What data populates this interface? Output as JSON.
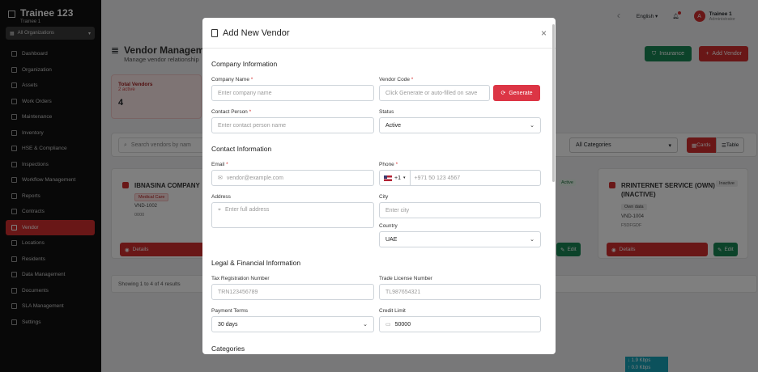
{
  "sidebar": {
    "app_name": "Trainee 123",
    "app_sub": "Trainee 1",
    "org_select": "All Organizations",
    "items": [
      {
        "label": "Dashboard"
      },
      {
        "label": "Organization"
      },
      {
        "label": "Assets"
      },
      {
        "label": "Work Orders"
      },
      {
        "label": "Maintenance"
      },
      {
        "label": "Inventory"
      },
      {
        "label": "HSE & Compliance"
      },
      {
        "label": "Inspections"
      },
      {
        "label": "Workflow Management"
      },
      {
        "label": "Reports"
      },
      {
        "label": "Contracts"
      },
      {
        "label": "Vendor",
        "active": true
      },
      {
        "label": "Locations"
      },
      {
        "label": "Residents"
      },
      {
        "label": "Data Management"
      },
      {
        "label": "Documents"
      },
      {
        "label": "SLA Management"
      },
      {
        "label": "Settings"
      }
    ]
  },
  "topbar": {
    "language": "English",
    "user_initial": "A",
    "user_name": "Trainee 1",
    "user_role": "Administrator"
  },
  "page": {
    "title": "Vendor Managem",
    "subtitle": "Manage vendor relationship",
    "insurance_label": "Insurance",
    "add_vendor_label": "Add Vendor",
    "stat": {
      "label": "Total Vendors",
      "sub": "2 active",
      "value": "4"
    },
    "search_placeholder": "Search vendors by nam",
    "category_filter": "All Categories",
    "view_cards": "Cards",
    "view_table": "Table",
    "card1": {
      "title": "IBNASINA COMPANY",
      "badge": "Medical Care",
      "code": "VND-1002",
      "code2": "0000",
      "details": "Details"
    },
    "card_mid": {
      "status": "Active",
      "edit": "Edit"
    },
    "card2": {
      "title": "RRINTERNET SERVICE (OWN) (INACTIVE)",
      "status": "Inactive",
      "badge": "Own data",
      "code": "VND-1004",
      "code2": "F5DFGDF",
      "details": "Details",
      "edit": "Edit"
    },
    "showing": "Showing 1 to 4 of 4 results",
    "speed": [
      "↓ 1.9 Kbps",
      "↑ 0.0 Kbps"
    ]
  },
  "modal": {
    "title": "Add New Vendor",
    "close": "×",
    "sections": {
      "company": "Company Information",
      "contact": "Contact Information",
      "legal": "Legal & Financial Information",
      "categories": "Categories"
    },
    "fields": {
      "company_name": {
        "label": "Company Name",
        "placeholder": "Enter company name"
      },
      "vendor_code": {
        "label": "Vendor Code",
        "placeholder": "Click Generate or auto-filled on save"
      },
      "generate": "Generate",
      "contact_person": {
        "label": "Contact Person",
        "placeholder": "Enter contact person name"
      },
      "status": {
        "label": "Status",
        "value": "Active"
      },
      "email": {
        "label": "Email",
        "placeholder": "vendor@example.com"
      },
      "phone": {
        "label": "Phone",
        "prefix": "+1",
        "placeholder": "+971 50 123 4567"
      },
      "address": {
        "label": "Address",
        "placeholder": "Enter full address"
      },
      "city": {
        "label": "City",
        "placeholder": "Enter city"
      },
      "country": {
        "label": "Country",
        "value": "UAE"
      },
      "trn": {
        "label": "Tax Registration Number",
        "placeholder": "TRN123456789"
      },
      "trade_license": {
        "label": "Trade License Number",
        "placeholder": "TL987654321"
      },
      "payment_terms": {
        "label": "Payment Terms",
        "value": "30 days"
      },
      "credit_limit": {
        "label": "Credit Limit",
        "value": "50000"
      }
    }
  }
}
